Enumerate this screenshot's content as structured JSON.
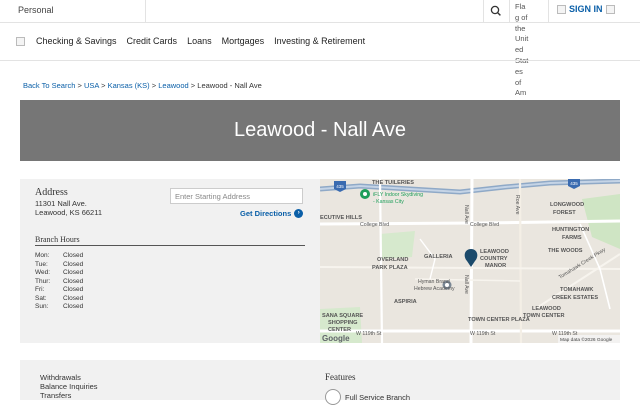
{
  "topbar": {
    "persona": "Personal",
    "flag_alt": "Flag of the United States of America",
    "signin": "SIGN IN"
  },
  "nav": {
    "items": [
      "Checking & Savings",
      "Credit Cards",
      "Loans",
      "Mortgages",
      "Investing & Retirement"
    ]
  },
  "breadcrumb": {
    "items": [
      "Back To Search",
      "USA",
      "Kansas (KS)",
      "Leawood"
    ],
    "current": "Leawood - Nall Ave",
    "separator": ">"
  },
  "hero": {
    "title": "Leawood - Nall Ave"
  },
  "address": {
    "heading": "Address",
    "line1": "11301 Nall Ave.",
    "line2": "Leawood, KS 66211"
  },
  "directions": {
    "placeholder": "Enter Starting Address",
    "button": "Get Directions"
  },
  "hours": {
    "heading": "Branch Hours",
    "rows": [
      {
        "day": "Mon:",
        "time": "Closed"
      },
      {
        "day": "Tue:",
        "time": "Closed"
      },
      {
        "day": "Wed:",
        "time": "Closed"
      },
      {
        "day": "Thur:",
        "time": "Closed"
      },
      {
        "day": "Fri:",
        "time": "Closed"
      },
      {
        "day": "Sat:",
        "time": "Closed"
      },
      {
        "day": "Sun:",
        "time": "Closed"
      }
    ]
  },
  "map": {
    "labels": {
      "tuileries": "THE TUILERIES",
      "skydiving1": "iFLY Indoor Skydiving",
      "skydiving2": "- Kansas City",
      "executive": "ECUTIVE HILLS",
      "collegeblvd1": "College Blvd",
      "collegeblvd2": "College Blvd",
      "longwood1": "LONGWOOD",
      "longwood2": "FOREST",
      "huntington1": "HUNTINGTON",
      "huntington2": "FARMS",
      "thewoods": "THE WOODS",
      "overland1": "OVERLAND",
      "overland2": "PARK PLAZA",
      "galleria": "GALLERIA",
      "lcm1": "LEAWOOD",
      "lcm2": "COUNTRY",
      "lcm3": "MANOR",
      "hebrew1": "Hyman Brand",
      "hebrew2": "Hebrew Academy",
      "aspiria": "ASPIRIA",
      "ltc1": "LEAWOOD",
      "ltc2": "TOWN CENTER",
      "tomahawk1": "TOMAHAWK",
      "tomahawk2": "CREEK ESTATES",
      "tomahawkpkwy": "Tomahawk Creek Pkwy",
      "sanasquare1": "SANA SQUARE",
      "sanasquare2": "SHOPPING",
      "sanasquare3": "CENTER",
      "119th1": "W 119th St",
      "119th2": "W 119th St",
      "119th3": "W 119th St",
      "tcp": "TOWN CENTER PLAZA",
      "nallave1": "Nall Ave",
      "nallave2": "Nall Ave",
      "roeave": "Roe Ave",
      "i435a": "435",
      "i435b": "435",
      "google": "Google",
      "attribution": "Map data ©2026 Google"
    }
  },
  "services": {
    "items": [
      "Withdrawals",
      "Balance Inquiries",
      "Transfers"
    ]
  },
  "features": {
    "heading": "Features",
    "items": [
      "Full Service Branch"
    ]
  }
}
